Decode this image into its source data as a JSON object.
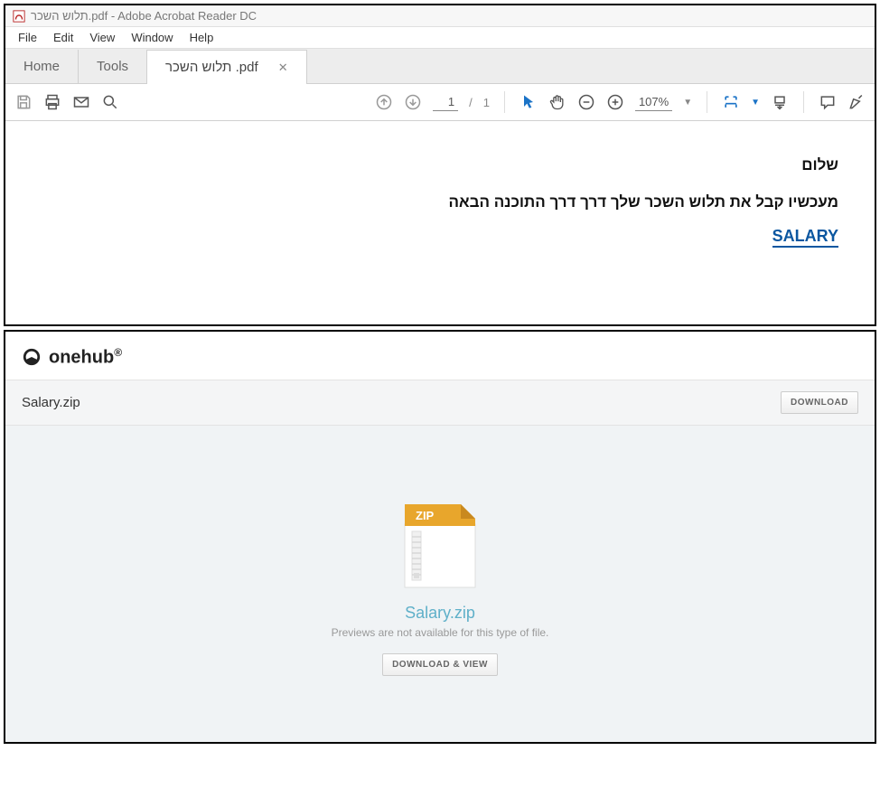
{
  "acrobat": {
    "title": "תלוש השכר.pdf - Adobe Acrobat Reader DC",
    "menu": [
      "File",
      "Edit",
      "View",
      "Window",
      "Help"
    ],
    "tabs": {
      "home": "Home",
      "tools": "Tools",
      "doc": "תלוש השכר .pdf"
    },
    "page_current": "1",
    "page_sep": "/",
    "page_total": "1",
    "zoom": "107%",
    "content": {
      "line1": "שלום",
      "line2": "מעכשיו קבל את תלוש השכר שלך דרך דרך התוכנה הבאה",
      "link": "SALARY"
    }
  },
  "onehub": {
    "brand": "onehub",
    "filename_bar": "Salary.zip",
    "download_btn": "DOWNLOAD",
    "zip_badge": "ZIP",
    "filename_big": "Salary.zip",
    "preview_msg": "Previews are not available for this type of file.",
    "download_view_btn": "DOWNLOAD & VIEW"
  }
}
